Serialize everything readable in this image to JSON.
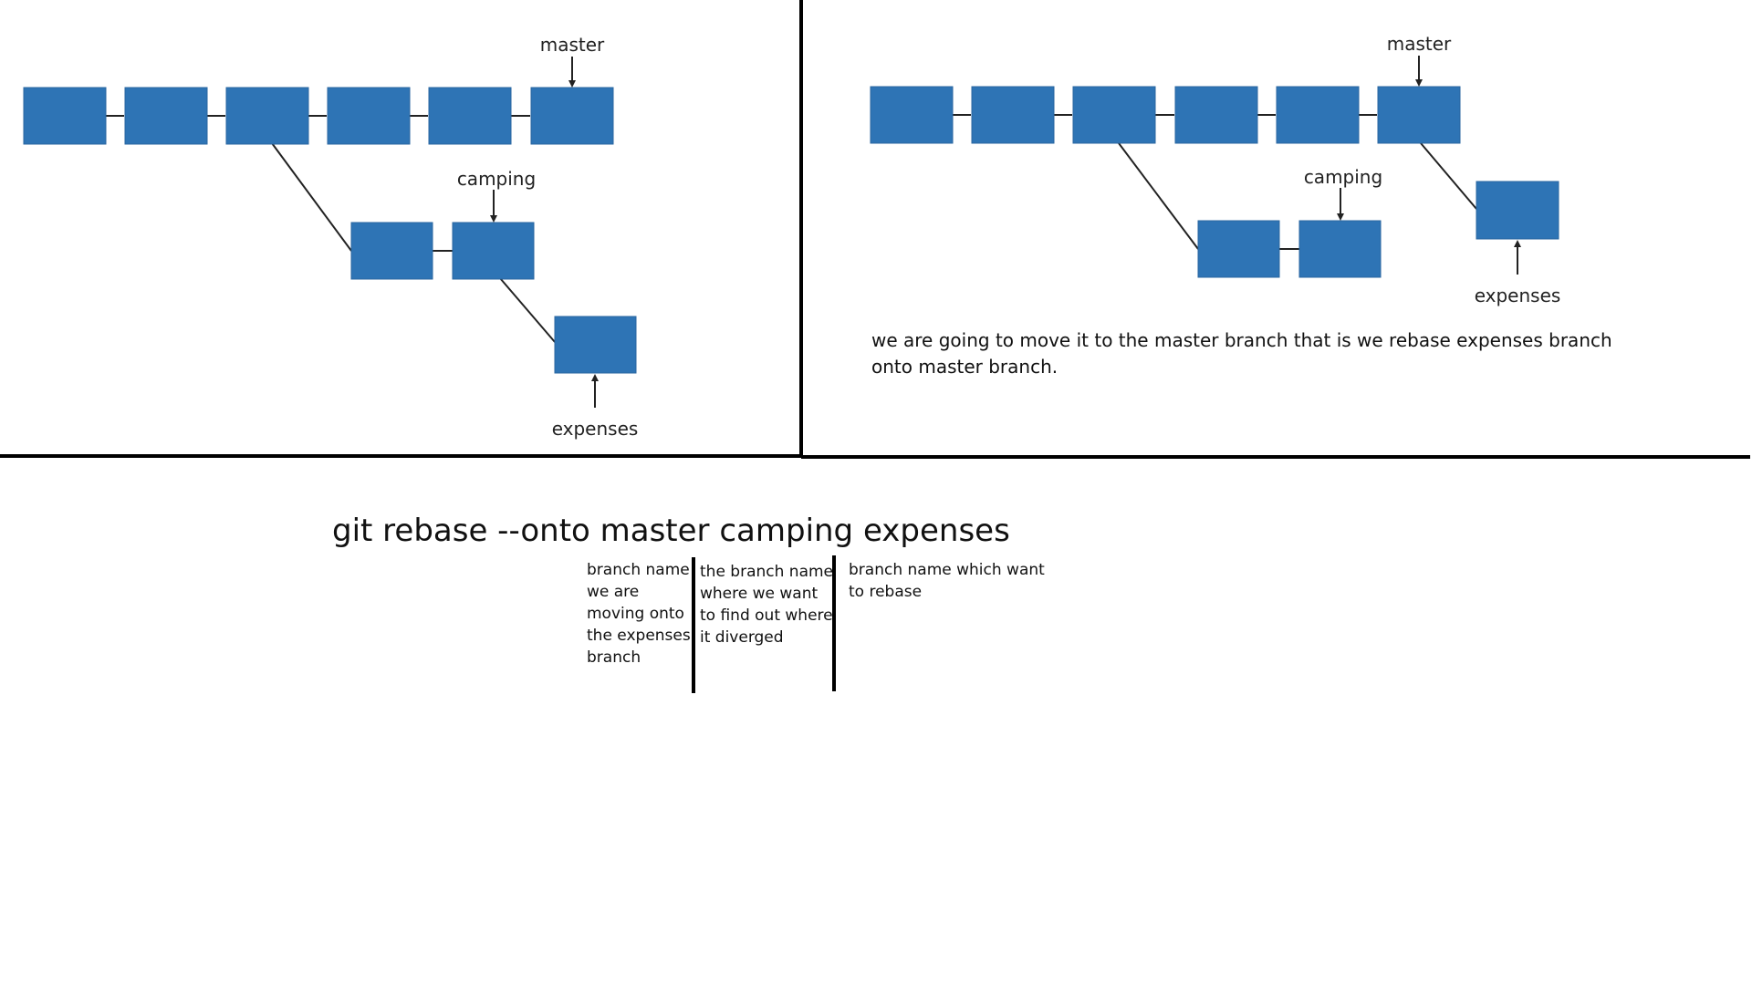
{
  "panels": {
    "before": {
      "labels": {
        "master": "master",
        "camping": "camping",
        "expenses": "expenses"
      }
    },
    "after": {
      "labels": {
        "master": "master",
        "camping": "camping",
        "expenses": "expenses"
      },
      "caption": "we are going to move it to the master branch that is we rebase expenses branch onto master branch."
    }
  },
  "command": {
    "text": "git rebase --onto master camping expenses",
    "annotations": [
      "branch name we are moving onto the expenses branch",
      "the branch name where we want to find out where it diverged",
      "branch name which want to rebase"
    ]
  },
  "colors": {
    "commit_fill": "#2E74B5",
    "commit_border": "#2A66A0",
    "line": "#222222",
    "divider": "#000000"
  }
}
